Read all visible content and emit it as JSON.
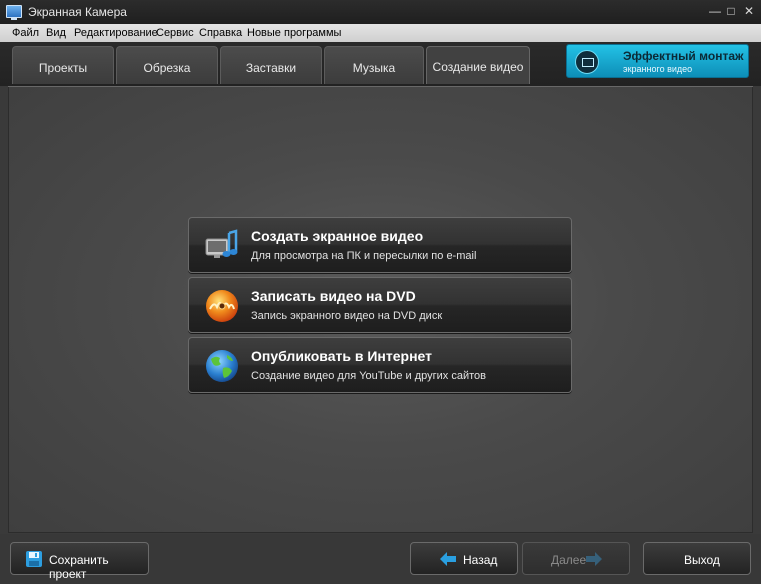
{
  "window": {
    "title": "Экранная Камера"
  },
  "menu": [
    "Файл",
    "Вид",
    "Редактирование",
    "Сервис",
    "Справка",
    "Новые программы"
  ],
  "tabs": [
    "Проекты",
    "Обрезка",
    "Заставки",
    "Музыка",
    "Создание видео"
  ],
  "active_tab": "Создание видео",
  "promo": {
    "line1": "Эффектный монтаж",
    "line2": "экранного видео"
  },
  "actions": [
    {
      "title": "Создать экранное видео",
      "subtitle": "Для просмотра на ПК и пересылки по e-mail",
      "icon": "monitor-music-icon"
    },
    {
      "title": "Записать видео на DVD",
      "subtitle": "Запись экранного видео на DVD диск",
      "icon": "dvd-disc-icon"
    },
    {
      "title": "Опубликовать в Интернет",
      "subtitle": "Создание видео для YouTube и других сайтов",
      "icon": "globe-icon"
    }
  ],
  "footer": {
    "save": "Сохранить проект",
    "back": "Назад",
    "next": "Далее",
    "exit": "Выход"
  },
  "colors": {
    "accent": "#12a7d2",
    "arrow": "#2a9fe0"
  }
}
